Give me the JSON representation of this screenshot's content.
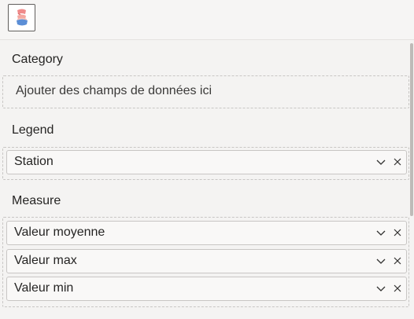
{
  "toolbar": {
    "visual_icon": "visual-type-icon"
  },
  "sections": {
    "category": {
      "label": "Category",
      "placeholder": "Ajouter des champs de données ici"
    },
    "legend": {
      "label": "Legend",
      "fields": [
        {
          "name": "Station"
        }
      ]
    },
    "measure": {
      "label": "Measure",
      "fields": [
        {
          "name": "Valeur moyenne"
        },
        {
          "name": "Valeur max"
        },
        {
          "name": "Valeur min"
        }
      ]
    }
  },
  "icons": {
    "chevron": "chevron-down-icon",
    "remove": "close-icon"
  }
}
